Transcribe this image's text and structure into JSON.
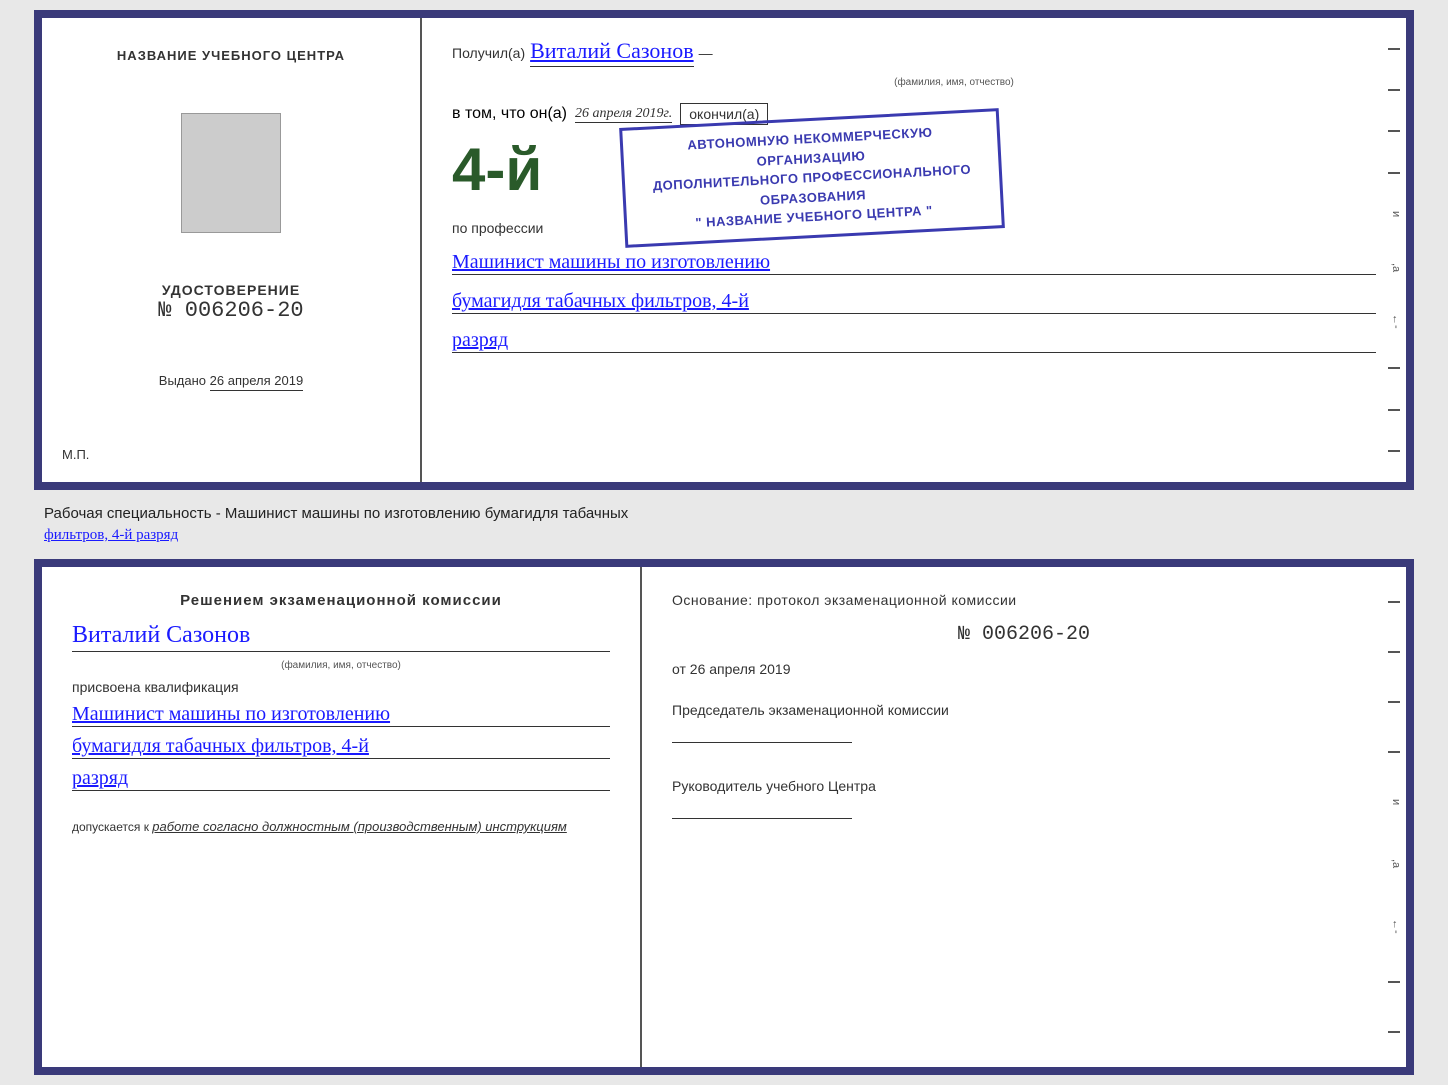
{
  "top_cert": {
    "left": {
      "title": "НАЗВАНИЕ УЧЕБНОГО ЦЕНТРА",
      "udostoverenie": "УДОСТОВЕРЕНИЕ",
      "number": "№ 006206-20",
      "vydano_label": "Выдано",
      "vydano_date": "26 апреля 2019",
      "mp": "М.П."
    },
    "right": {
      "poluchil": "Получил(а)",
      "fio": "Виталий Сазонов",
      "fio_subtitle": "(фамилия, имя, отчество)",
      "dash": "—",
      "vtom": "в том, что он(а)",
      "date": "26 апреля 2019г.",
      "okoncil": "окончил(а)",
      "big_number": "4-й",
      "stamp_line1": "АВТОНОМНУЮ НЕКОММЕРЧЕСКУЮ ОРГАНИЗАЦИЮ",
      "stamp_line2": "ДОПОЛНИТЕЛЬНОГО ПРОФЕССИОНАЛЬНОГО ОБРАЗОВАНИЯ",
      "stamp_line3": "\" НАЗВАНИЕ УЧЕБНОГО ЦЕНТРА \"",
      "po_professii": "по профессии",
      "profession1": "Машинист машины по изготовлению",
      "profession2": "бумагидля табачных фильтров, 4-й",
      "profession3": "разряд"
    }
  },
  "middle": {
    "text1": "Рабочая специальность - Машинист машины по изготовлению бумагидля табачных",
    "text2": "фильтров, 4-й разряд"
  },
  "bottom_cert": {
    "left": {
      "resheniyem": "Решением  экзаменационной  комиссии",
      "fio": "Виталий Сазонов",
      "fio_subtitle": "(фамилия, имя, отчество)",
      "prisvoena": "присвоена квалификация",
      "profession1": "Машинист машины по изготовлению",
      "profession2": "бумагидля табачных фильтров, 4-й",
      "profession3": "разряд",
      "dopuskaetsya": "допускается к",
      "dopusk_text": "работе согласно должностным (производственным) инструкциям"
    },
    "right": {
      "osnovanie": "Основание: протокол экзаменационной  комиссии",
      "number": "№  006206-20",
      "ot_label": "от",
      "ot_date": "26 апреля 2019",
      "predsedatel": "Председатель экзаменационной комиссии",
      "rukovoditel": "Руководитель учебного Центра"
    }
  }
}
